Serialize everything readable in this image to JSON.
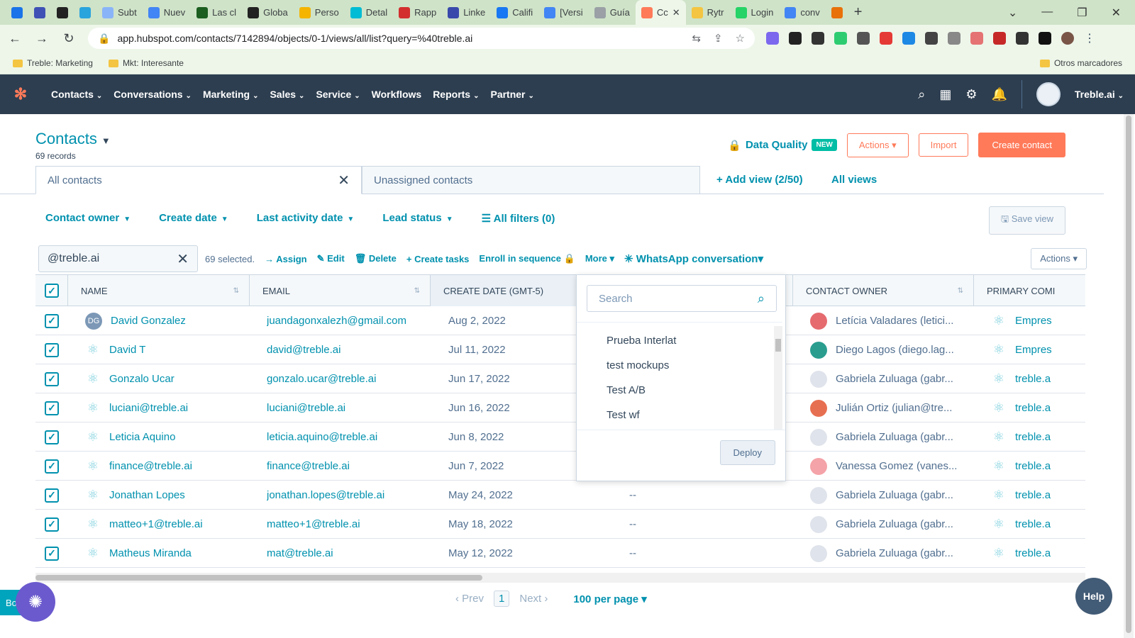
{
  "browser": {
    "tabs": [
      "Subt",
      "Nuev",
      "Las cl",
      "Globa",
      "Perso",
      "Detal",
      "Rapp",
      "Linke",
      "Califi",
      "[Versi",
      "Guía",
      "Cc",
      "Rytr",
      "Login",
      "conv"
    ],
    "address": "app.hubspot.com/contacts/7142894/objects/0-1/views/all/list?query=%40treble.ai",
    "bookmarks": [
      "Treble: Marketing",
      "Mkt: Interesante"
    ],
    "other_bookmarks": "Otros marcadores"
  },
  "nav": {
    "items": [
      "Contacts",
      "Conversations",
      "Marketing",
      "Sales",
      "Service",
      "Workflows",
      "Reports",
      "Partner"
    ],
    "account": "Treble.ai"
  },
  "header": {
    "title": "Contacts",
    "records": "69 records",
    "data_quality": "Data Quality",
    "new_badge": "NEW",
    "actions": "Actions",
    "import": "Import",
    "create_contact": "Create contact"
  },
  "views": {
    "active": "All contacts",
    "inactive": "Unassigned contacts",
    "add_view": "Add view (2/50)",
    "all_views": "All views"
  },
  "filters": {
    "items": [
      "Contact owner",
      "Create date",
      "Last activity date",
      "Lead status"
    ],
    "all_filters": "All filters (0)",
    "save_view": "Save view"
  },
  "bulk": {
    "search_value": "@treble.ai",
    "selected": "69 selected.",
    "assign": "Assign",
    "edit": "Edit",
    "delete": "Delete",
    "create_tasks": "Create tasks",
    "enroll": "Enroll in sequence",
    "more": "More",
    "whatsapp": "WhatsApp conversation",
    "actions": "Actions"
  },
  "table": {
    "headers": {
      "name": "NAME",
      "email": "EMAIL",
      "create_date": "CREATE DATE (GMT-5)",
      "owner": "CONTACT OWNER",
      "company": "PRIMARY COMI"
    },
    "rows": [
      {
        "name": "David Gonzalez",
        "email": "juandagonxalezh@gmail.com",
        "date": "Aug 2, 2022",
        "last": "",
        "owner": "Letícia Valadares (letici...",
        "company": "Empres"
      },
      {
        "name": "David T",
        "email": "david@treble.ai",
        "date": "Jul 11, 2022",
        "last": "",
        "owner": "Diego Lagos (diego.lag...",
        "company": "Empres"
      },
      {
        "name": "Gonzalo Ucar",
        "email": "gonzalo.ucar@treble.ai",
        "date": "Jun 17, 2022",
        "last": "",
        "owner": "Gabriela Zuluaga (gabr...",
        "company": "treble.a"
      },
      {
        "name": "luciani@treble.ai",
        "email": "luciani@treble.ai",
        "date": "Jun 16, 2022",
        "last": "",
        "owner": "Julián Ortiz (julian@tre...",
        "company": "treble.a"
      },
      {
        "name": "Leticia Aquino",
        "email": "leticia.aquino@treble.ai",
        "date": "Jun 8, 2022",
        "last": "",
        "owner": "Gabriela Zuluaga (gabr...",
        "company": "treble.a"
      },
      {
        "name": "finance@treble.ai",
        "email": "finance@treble.ai",
        "date": "Jun 7, 2022",
        "last": "",
        "owner": "Vanessa Gomez (vanes...",
        "company": "treble.a"
      },
      {
        "name": "Jonathan Lopes",
        "email": "jonathan.lopes@treble.ai",
        "date": "May 24, 2022",
        "last": "--",
        "owner": "Gabriela Zuluaga (gabr...",
        "company": "treble.a"
      },
      {
        "name": "matteo+1@treble.ai",
        "email": "matteo+1@treble.ai",
        "date": "May 18, 2022",
        "last": "--",
        "owner": "Gabriela Zuluaga (gabr...",
        "company": "treble.a"
      },
      {
        "name": "Matheus Miranda",
        "email": "mat@treble.ai",
        "date": "May 12, 2022",
        "last": "--",
        "owner": "Gabriela Zuluaga (gabr...",
        "company": "treble.a"
      }
    ],
    "dg_initials": "DG"
  },
  "dropdown": {
    "search_placeholder": "Search",
    "items": [
      "Prueba Interlat",
      "test mockups",
      "Test A/B",
      "Test wf"
    ],
    "deploy": "Deploy"
  },
  "pagination": {
    "prev": "Prev",
    "page": "1",
    "next": "Next",
    "per_page": "100 per page"
  },
  "help": "Help",
  "chat_tab": "Bo"
}
